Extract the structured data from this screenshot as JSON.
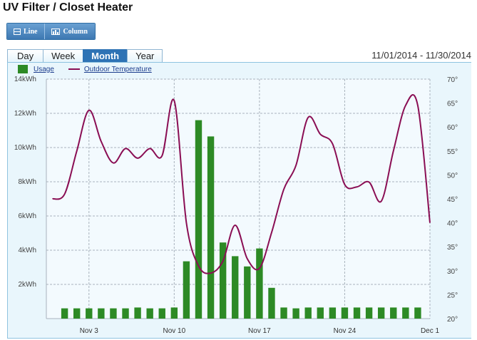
{
  "page": {
    "title": "UV Filter / Closet Heater"
  },
  "view_buttons": {
    "line_label": "Line",
    "column_label": "Column"
  },
  "tabs": [
    {
      "label": "Day",
      "active": false
    },
    {
      "label": "Week",
      "active": false
    },
    {
      "label": "Month",
      "active": true
    },
    {
      "label": "Year",
      "active": false
    }
  ],
  "date_range": "11/01/2014 - 11/30/2014",
  "legend": {
    "usage": "Usage",
    "temperature": "Outdoor Temperature"
  },
  "colors": {
    "usage": "#2d8a25",
    "temperature": "#8a0e54",
    "accent": "#2e73b5"
  },
  "chart_data": {
    "type": "bar",
    "title": "",
    "x_tick_labels": [
      "Nov 3",
      "Nov 10",
      "Nov 17",
      "Nov 24",
      "Dec 1"
    ],
    "x_tick_days": [
      3,
      10,
      17,
      24,
      31
    ],
    "xlim": [
      -0.5,
      31
    ],
    "grid": true,
    "y_left": {
      "unit": "kWh",
      "ylim": [
        0,
        14
      ],
      "tick_values": [
        2,
        4,
        6,
        8,
        10,
        12,
        14
      ],
      "tick_labels": [
        "2kWh",
        "4kWh",
        "6kWh",
        "8kWh",
        "10kWh",
        "12kWh",
        "14kWh"
      ]
    },
    "y_right": {
      "unit": "°",
      "ylim": [
        20,
        70
      ],
      "tick_values": [
        20,
        25,
        30,
        35,
        40,
        45,
        50,
        55,
        60,
        65,
        70
      ],
      "tick_labels": [
        "20°",
        "25°",
        "30°",
        "35°",
        "40°",
        "45°",
        "50°",
        "55°",
        "60°",
        "65°",
        "70°"
      ]
    },
    "series": [
      {
        "name": "Usage",
        "type": "bar",
        "axis": "left",
        "days": [
          1,
          2,
          3,
          4,
          5,
          6,
          7,
          8,
          9,
          10,
          11,
          12,
          13,
          14,
          15,
          16,
          17,
          18,
          19,
          20,
          21,
          22,
          23,
          24,
          25,
          26,
          27,
          28,
          29,
          30
        ],
        "values": [
          0.6,
          0.6,
          0.6,
          0.6,
          0.6,
          0.6,
          0.65,
          0.6,
          0.6,
          0.65,
          3.35,
          11.6,
          10.65,
          4.45,
          3.65,
          3.05,
          4.1,
          1.8,
          0.65,
          0.6,
          0.65,
          0.65,
          0.65,
          0.65,
          0.65,
          0.65,
          0.65,
          0.65,
          0.65,
          0.65
        ]
      },
      {
        "name": "Outdoor Temperature",
        "type": "line",
        "axis": "right",
        "x": [
          0,
          1,
          2,
          3,
          4,
          5,
          6,
          7,
          8,
          9,
          10,
          11,
          12,
          13,
          14,
          15,
          16,
          17,
          18,
          19,
          20,
          21,
          22,
          23,
          24,
          25,
          26,
          27,
          28,
          29,
          30,
          31
        ],
        "y": [
          45,
          46,
          55,
          63.5,
          57,
          52.5,
          55.5,
          53.5,
          55.5,
          54,
          65.5,
          40,
          31,
          29.5,
          32,
          39.5,
          32.5,
          30.5,
          38,
          47,
          52,
          62,
          58.5,
          56.5,
          48,
          47.5,
          48.5,
          44.5,
          55,
          64.5,
          64.5,
          40
        ]
      }
    ]
  }
}
